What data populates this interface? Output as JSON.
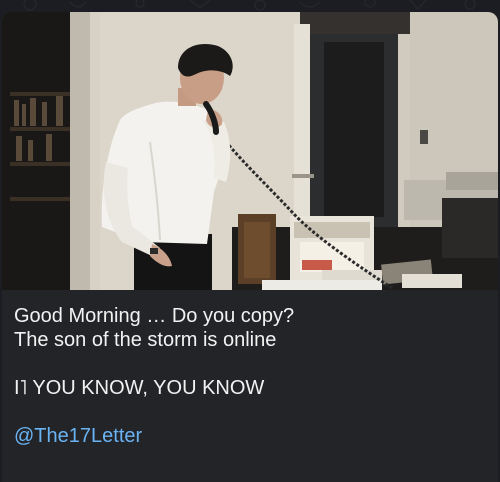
{
  "message": {
    "photo_icon": "photo-image",
    "caption_lines": [
      "Good Morning … Do you copy?",
      "The son of the storm is online",
      "",
      "I˥ YOU KNOW, YOU KNOW",
      "",
      "@The17Letter"
    ],
    "mention": "@The17Letter"
  },
  "colors": {
    "background": "#1b1d22",
    "bubble": "#222428",
    "text": "#f2f2f2",
    "link": "#6ab3f3"
  }
}
